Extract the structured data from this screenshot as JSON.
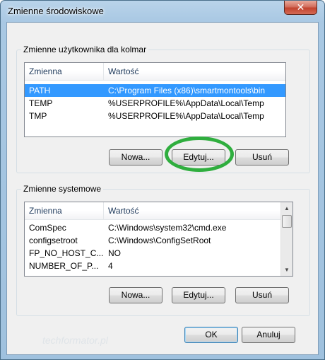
{
  "window": {
    "title": "Zmienne środowiskowe",
    "close_glyph": "✕"
  },
  "user_vars": {
    "group_title": "Zmienne użytkownika dla kolmar",
    "columns": [
      "Zmienna",
      "Wartość"
    ],
    "rows": [
      {
        "name": "PATH",
        "value": "C:\\Program Files (x86)\\smartmontools\\bin",
        "selected": true
      },
      {
        "name": "TEMP",
        "value": "%USERPROFILE%\\AppData\\Local\\Temp",
        "selected": false
      },
      {
        "name": "TMP",
        "value": "%USERPROFILE%\\AppData\\Local\\Temp",
        "selected": false
      }
    ],
    "buttons": {
      "new": "Nowa...",
      "edit": "Edytuj...",
      "delete": "Usuń"
    }
  },
  "system_vars": {
    "group_title": "Zmienne systemowe",
    "columns": [
      "Zmienna",
      "Wartość"
    ],
    "rows": [
      {
        "name": "ComSpec",
        "value": "C:\\Windows\\system32\\cmd.exe"
      },
      {
        "name": "configsetroot",
        "value": "C:\\Windows\\ConfigSetRoot"
      },
      {
        "name": "FP_NO_HOST_C...",
        "value": "NO"
      },
      {
        "name": "NUMBER_OF_P...",
        "value": "4"
      }
    ],
    "buttons": {
      "new": "Nowa...",
      "edit": "Edytuj...",
      "delete": "Usuń"
    },
    "scroll_up": "▲",
    "scroll_down": "▼"
  },
  "footer": {
    "ok": "OK",
    "cancel": "Anuluj"
  },
  "watermark": "techformator.pl",
  "colors": {
    "selection": "#3399ff",
    "highlight_oval": "#2fae3e"
  }
}
